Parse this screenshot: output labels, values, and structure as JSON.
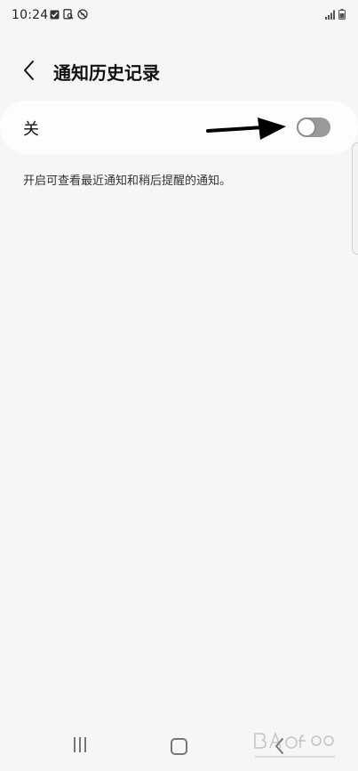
{
  "status_bar": {
    "time": "10:24"
  },
  "header": {
    "title": "通知历史记录"
  },
  "toggle": {
    "label": "关",
    "state": "off"
  },
  "description": "开启可查看最近通知和稍后提醒的通知。",
  "colors": {
    "background": "#f6f6f6",
    "card": "#fdfdfd",
    "switch_track": "#9a9a9a"
  }
}
